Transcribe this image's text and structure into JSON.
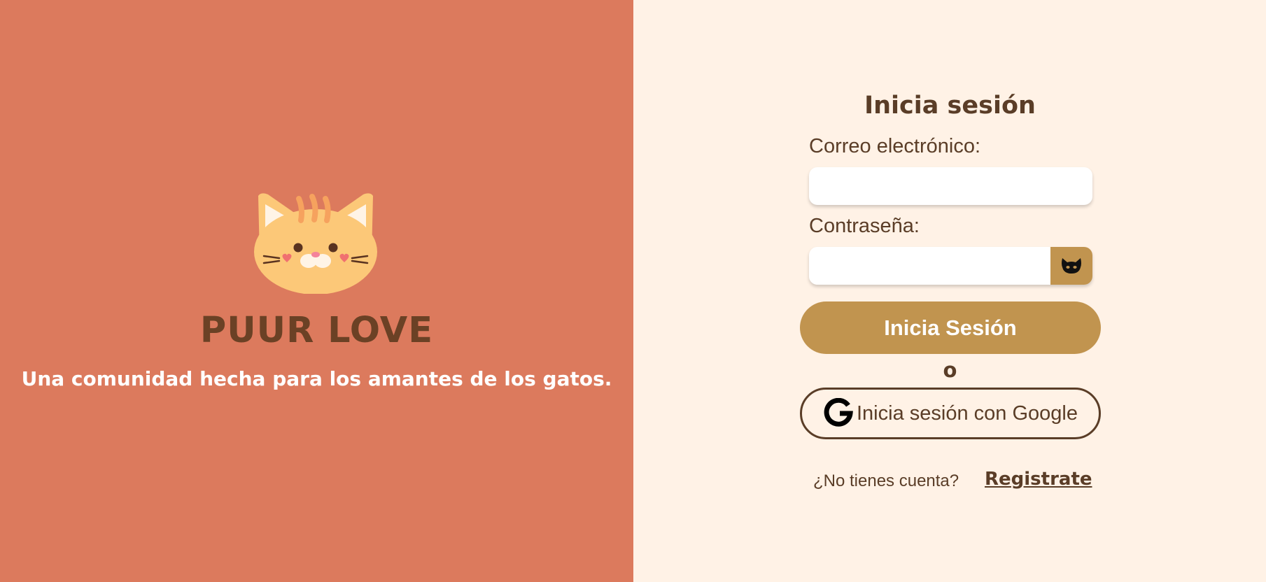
{
  "brand": {
    "name": "PUUR LOVE",
    "tagline": "Una comunidad hecha para los amantes de los gatos.",
    "logo_icon": "cat-face-icon"
  },
  "login": {
    "title": "Inicia sesión",
    "email_label": "Correo electrónico:",
    "email_value": "",
    "password_label": "Contraseña:",
    "password_value": "",
    "password_toggle_icon": "black-cat-icon",
    "submit_label": "Inicia Sesión",
    "or_text": "o",
    "google_icon": "google-g-icon",
    "google_label": "Inicia sesión con Google",
    "no_account_text": "¿No tienes cuenta?",
    "register_link": "Registrate"
  },
  "colors": {
    "left_bg": "#dc7a5d",
    "right_bg": "#fff2e6",
    "accent": "#c1944f",
    "text_dark": "#5a3d27",
    "brand_text": "#6b4125"
  }
}
